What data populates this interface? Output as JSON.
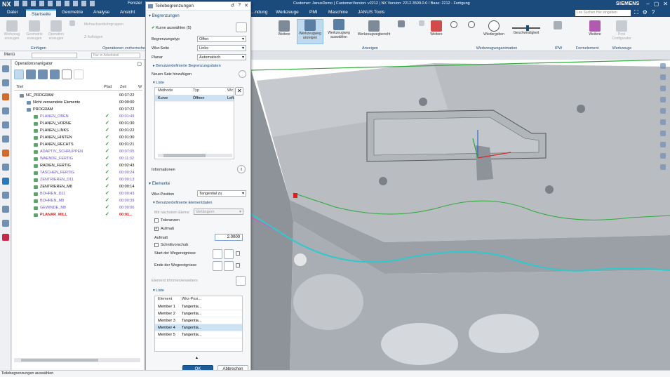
{
  "titlebar": {
    "logo": "NX",
    "window_menu": "Fenster",
    "title": "Customer: JanusDemo | CustomerVersion: v2212 | NX Version: 2212.3509.0.0 / Base: 2212 - Fertigung",
    "brand": "SIEMENS"
  },
  "menubar": {
    "tabs": [
      "Datei",
      "Startseite",
      "Geometrie",
      "Analyse",
      "Ansicht",
      "...ndung",
      "Werkzeuge",
      "PMI",
      "Maschine",
      "JANUS Tools"
    ],
    "active_tab": "Startseite",
    "search_placeholder": "Los Suchen Her eingeben"
  },
  "ribbon": {
    "einfuegen": {
      "label": "Einfügen",
      "buttons": [
        "Werkzeug erzeugen",
        "Geometrie erzeugen",
        "Operation erzeugen"
      ],
      "small": [
        "Methode erzeugen",
        "Programm erzeugen"
      ]
    },
    "operationen": {
      "label": "Operationen vorherrschen",
      "items": [
        "Mehrachsenbohrgruppen",
        "Z-Aufträgen"
      ]
    },
    "anzeigen": {
      "label": "Anzeigen",
      "buttons": [
        "Werkzeugweg anzeigen",
        "Werkzeugweg auswählen",
        "Werkzeugwegbericht",
        "Weitere"
      ]
    },
    "animation": {
      "label": "Werkzeugweganimation",
      "buttons": [
        "Wiedergeben",
        "Geschwindigkeit",
        "Weitere"
      ]
    },
    "ipw": {
      "label": "IPW"
    },
    "formelement": {
      "label": "Formelement"
    },
    "werkzeuge": {
      "label": "Werkzeuge",
      "items": [
        "Post Configurator"
      ]
    }
  },
  "toolbar2": {
    "menu": "Menü",
    "filter_placeholder": "Nur in Arbeitsteil"
  },
  "navigator": {
    "title": "Operationsnavigator",
    "columns": [
      "Titel",
      "Pfad",
      "Zeit",
      "W"
    ],
    "rows": [
      {
        "name": "NC_PROGRAM",
        "time": "00:37:22",
        "check": false,
        "style": "normal",
        "indent": 0
      },
      {
        "name": "Nicht verwendete Elemente",
        "time": "00:00:00",
        "check": false,
        "style": "normal",
        "indent": 1
      },
      {
        "name": "PROGRAM",
        "time": "00:37:22",
        "check": false,
        "style": "normal",
        "indent": 1
      },
      {
        "name": "PLANEN_OBEN",
        "time": "00:01:49",
        "check": true,
        "style": "blue",
        "indent": 2
      },
      {
        "name": "PLANEN_VORNE",
        "time": "00:01:30",
        "check": true,
        "style": "normal",
        "indent": 2
      },
      {
        "name": "PLANEN_LINKS",
        "time": "00:01:22",
        "check": true,
        "style": "normal",
        "indent": 2
      },
      {
        "name": "PLANEN_HINTEN",
        "time": "00:01:30",
        "check": true,
        "style": "normal",
        "indent": 2
      },
      {
        "name": "PLANEN_RECHTS",
        "time": "00:01:21",
        "check": true,
        "style": "normal",
        "indent": 2
      },
      {
        "name": "ADAPTIV_SCHRUPPEN",
        "time": "00:07:05",
        "check": true,
        "style": "blue",
        "indent": 2
      },
      {
        "name": "WAENDE_FERTIG",
        "time": "00:11:32",
        "check": true,
        "style": "blue",
        "indent": 2
      },
      {
        "name": "RADIEN_FERTIG",
        "time": "00:02:43",
        "check": true,
        "style": "normal",
        "indent": 2
      },
      {
        "name": "TASCHEN_FERTIG",
        "time": "00:00:24",
        "check": true,
        "style": "blue",
        "indent": 2
      },
      {
        "name": "ZENTRIEREN_D11",
        "time": "00:00:13",
        "check": true,
        "style": "blue",
        "indent": 2
      },
      {
        "name": "ZENTRIEREN_M8",
        "time": "00:00:14",
        "check": true,
        "style": "normal",
        "indent": 2
      },
      {
        "name": "BOHREN_D11",
        "time": "00:00:43",
        "check": true,
        "style": "blue",
        "indent": 2
      },
      {
        "name": "BOHREN_M8",
        "time": "00:00:39",
        "check": true,
        "style": "blue",
        "indent": 2
      },
      {
        "name": "GEWINDE_M8",
        "time": "00:00:06",
        "check": true,
        "style": "blue",
        "indent": 2
      },
      {
        "name": "PLANAR_MILL",
        "time": "00:01...",
        "check": true,
        "style": "red",
        "indent": 2
      }
    ]
  },
  "dialog": {
    "title": "Teilebegrenzungen",
    "section_begrenzungen": "Begrenzungen",
    "kurve_auswaehlen": "Kurve auswählen (5)",
    "fields": [
      {
        "label": "Begrenzungstyp",
        "value": "Offen"
      },
      {
        "label": "Wkz-Seite",
        "value": "Links"
      },
      {
        "label": "Planar",
        "value": "Automatisch"
      }
    ],
    "benutzerdefiniert_begrenzung": "Benutzerdefinierte Begrenzungsdaten",
    "neuen_satz": "Neuen Satz hinzufügen",
    "liste_label": "Liste",
    "list1": {
      "columns": [
        "Methode",
        "Typ",
        "Wz"
      ],
      "rows": [
        {
          "methode": "Kurve",
          "typ": "Öffnen",
          "wz": "Left"
        }
      ]
    },
    "informationen": "Informationen",
    "section_elemente": "Elemente",
    "wkz_position_label": "Wkz-Position",
    "wkz_position_value": "Tangential zu",
    "benutzerdefiniert_element": "Benutzerdefinierte Elementdaten",
    "mit_naechstem_label": "Mit nächstem Eleme",
    "mit_naechstem_value": "Verlängern",
    "toleranzen": "Toleranzen",
    "aufmass_checkbox": "Aufmaß",
    "aufmass_label": "Aufmaß",
    "aufmass_value": "2.0000",
    "schnittvorschub": "Schnittvorschub",
    "start_wegereignisse": "Start der Wegereignisse",
    "ende_wegereignisse": "Ende der Wegereignisse",
    "element_trimmen": "Element trimmen/erweitern",
    "liste2_label": "Liste",
    "list2": {
      "columns": [
        "Element",
        "Wkz-Posi..."
      ],
      "rows": [
        {
          "element": "Member 1",
          "pos": "Tangentia..."
        },
        {
          "element": "Member 2",
          "pos": "Tangentia..."
        },
        {
          "element": "Member 3",
          "pos": "Tangentia..."
        },
        {
          "element": "Member 4",
          "pos": "Tangentia..."
        },
        {
          "element": "Member 5",
          "pos": "Tangentia..."
        }
      ]
    },
    "ok": "OK",
    "cancel": "Abbrechen"
  },
  "status": "Teilebegrenzungen auswählen"
}
